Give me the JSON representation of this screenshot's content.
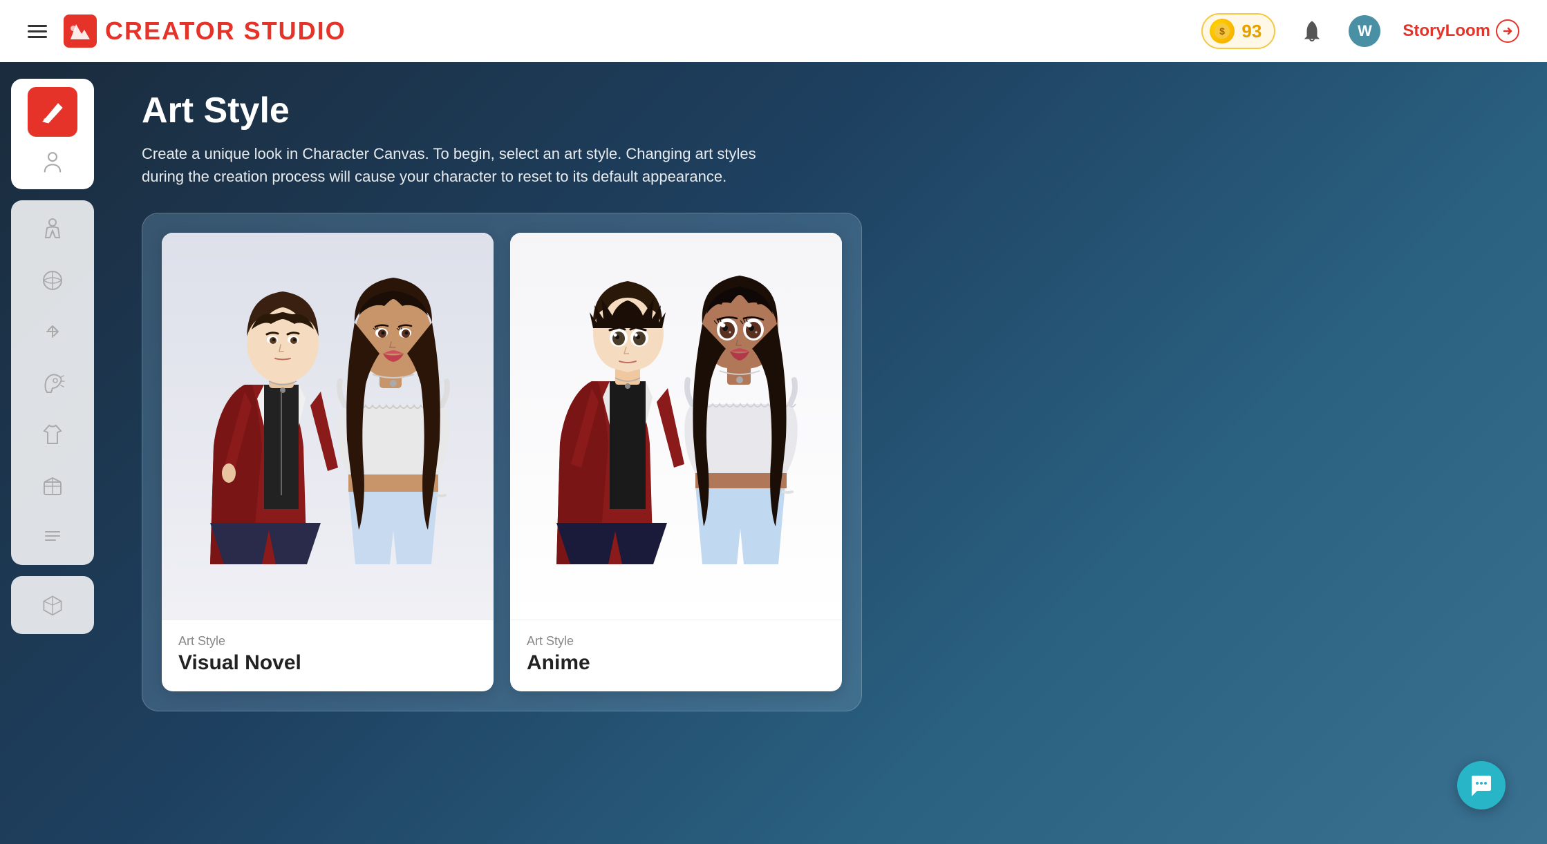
{
  "header": {
    "menu_label": "Menu",
    "logo_text": "CREATOR STUDIO",
    "coin_count": "93",
    "user_initial": "W",
    "storyloom_label": "StoryLoom"
  },
  "page": {
    "title": "Art Style",
    "description": "Create a unique look in Character Canvas. To begin, select an art style. Changing art styles during the creation process will cause your character to reset to its default appearance."
  },
  "art_styles": [
    {
      "label": "Art Style",
      "name": "Visual Novel"
    },
    {
      "label": "Art Style",
      "name": "Anime"
    }
  ],
  "sidebar": {
    "tools": [
      {
        "id": "brush",
        "label": "Brush Tool",
        "active": true
      },
      {
        "id": "person",
        "label": "Character Tool"
      }
    ],
    "middle_tools": [
      {
        "id": "body",
        "label": "Body"
      },
      {
        "id": "face",
        "label": "Face"
      },
      {
        "id": "pose",
        "label": "Pose"
      },
      {
        "id": "hair",
        "label": "Hair"
      },
      {
        "id": "outfit",
        "label": "Outfit"
      },
      {
        "id": "accessories",
        "label": "Accessories"
      },
      {
        "id": "texture",
        "label": "Texture"
      }
    ],
    "bottom_tools": [
      {
        "id": "cube",
        "label": "3D View"
      }
    ]
  },
  "colors": {
    "accent_red": "#e63329",
    "teal": "#29b5c8",
    "background_dark": "#1a3a5c"
  }
}
